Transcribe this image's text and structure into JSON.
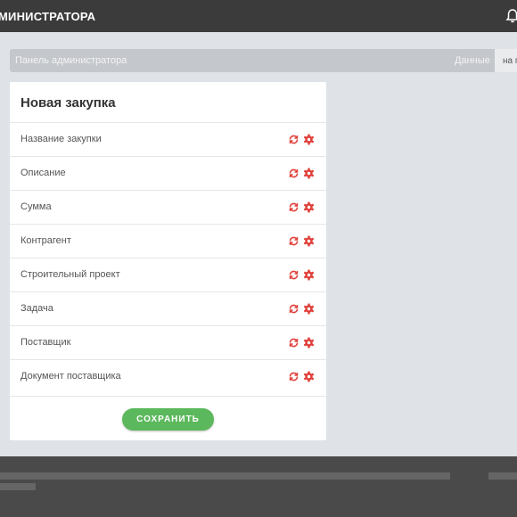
{
  "header": {
    "title": "МИНИСТРАТОРА",
    "bell_icon": "bell-icon"
  },
  "breadcrumb": {
    "left": "Панель администратора",
    "right": "Данные",
    "tab": "на г"
  },
  "card": {
    "title": "Новая закупка",
    "rows": [
      {
        "label": "Название закупки"
      },
      {
        "label": "Описание"
      },
      {
        "label": "Сумма"
      },
      {
        "label": "Контрагент"
      },
      {
        "label": "Строительный проект"
      },
      {
        "label": "Задача"
      },
      {
        "label": "Поставщик"
      },
      {
        "label": "Документ поставщика"
      }
    ],
    "save_label": "СОХРАНИТЬ"
  },
  "colors": {
    "accent_red": "#e0403a",
    "save_green": "#5cb85c",
    "topbar": "#3b3b3b"
  }
}
